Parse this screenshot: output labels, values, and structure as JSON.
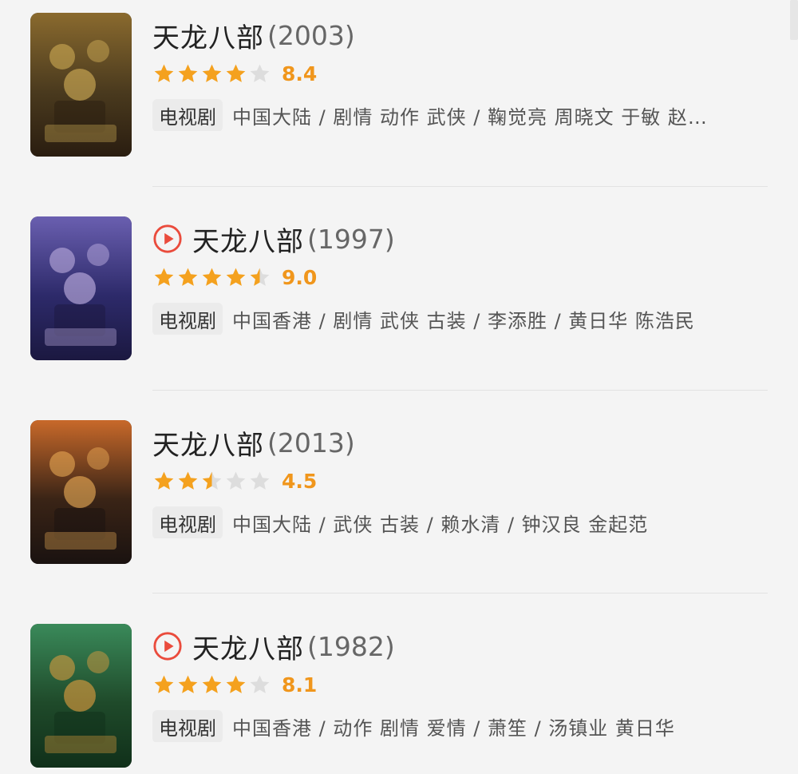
{
  "colors": {
    "star_on": "#f4a11e",
    "star_off": "#dddddd",
    "play": "#ea4b3c",
    "score": "#f0961c"
  },
  "items": [
    {
      "title": "天龙八部",
      "year": "(2003)",
      "has_play": false,
      "stars": 4,
      "half": false,
      "score": "8.4",
      "tag": "电视剧",
      "meta": "中国大陆 / 剧情 动作 武侠 / 鞠觉亮 周晓文 于敏 赵…",
      "poster_theme": "gold"
    },
    {
      "title": "天龙八部",
      "year": "(1997)",
      "has_play": true,
      "stars": 4,
      "half": true,
      "score": "9.0",
      "tag": "电视剧",
      "meta": "中国香港 / 剧情 武侠 古装 / 李添胜 / 黄日华 陈浩民",
      "poster_theme": "purple"
    },
    {
      "title": "天龙八部",
      "year": "(2013)",
      "has_play": false,
      "stars": 2,
      "half": true,
      "score": "4.5",
      "tag": "电视剧",
      "meta": "中国大陆 / 武侠 古装 / 赖水清 / 钟汉良 金起范",
      "poster_theme": "orange"
    },
    {
      "title": "天龙八部",
      "year": "(1982)",
      "has_play": true,
      "stars": 4,
      "half": false,
      "score": "8.1",
      "tag": "电视剧",
      "meta": "中国香港 / 动作 剧情 爱情 / 萧笙 / 汤镇业 黄日华",
      "poster_theme": "green"
    }
  ]
}
